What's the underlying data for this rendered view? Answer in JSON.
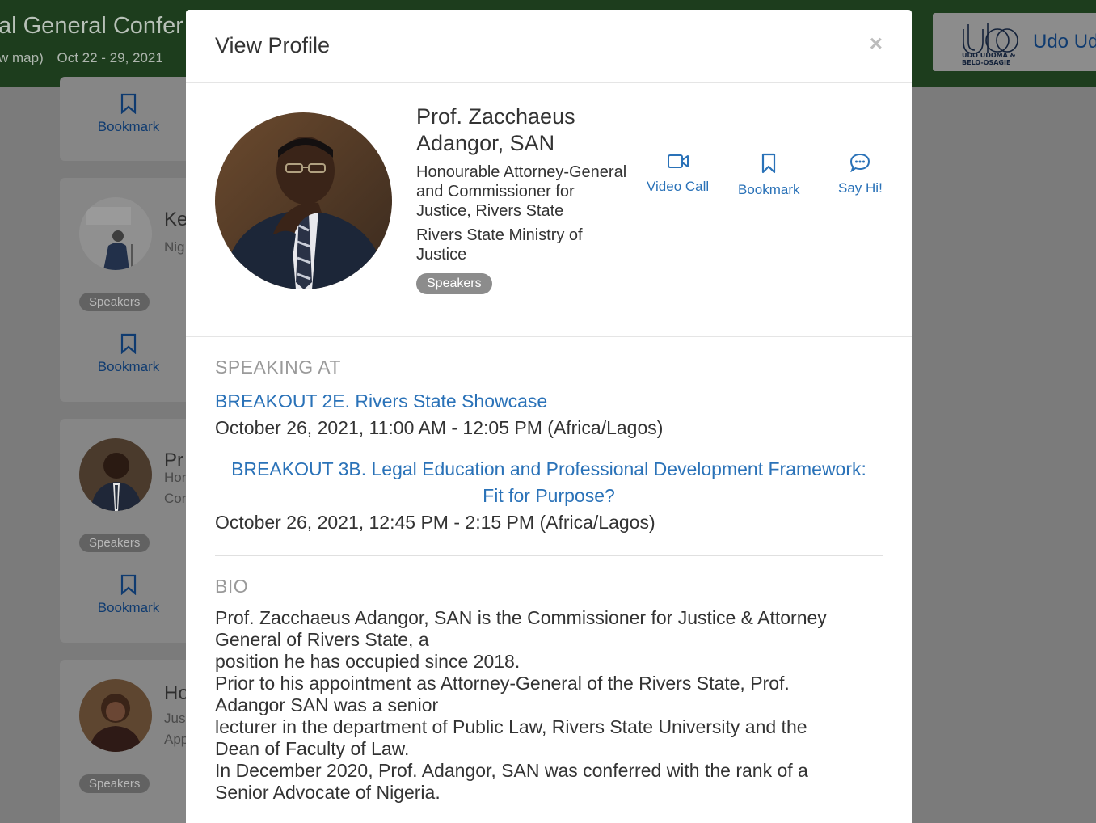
{
  "background": {
    "event_title": "al General Confer",
    "event_map_link": "w map)",
    "event_dates": "Oct 22 - 29, 2021",
    "sponsor": {
      "name": "Udo Ud",
      "logo_text_line1": "UDO UDOMA &",
      "logo_text_line2": "BELO-OSAGIE"
    },
    "cards": [
      {
        "bookmark_label": "Bookmark"
      },
      {
        "name": "Ke",
        "subtitle": "Nig",
        "tag": "Speakers",
        "bookmark_label": "Bookmark"
      },
      {
        "name": "Pr",
        "subtitle_line1": "Hor",
        "subtitle_line2": "Cor",
        "tag": "Speakers",
        "bookmark_label": "Bookmark"
      },
      {
        "name": "Ho",
        "subtitle_line1": "Jus",
        "subtitle_line2": "App",
        "tag": "Speakers"
      }
    ]
  },
  "modal": {
    "title": "View Profile",
    "close_symbol": "×",
    "profile": {
      "name": "Prof. Zacchaeus Adangor, SAN",
      "title": "Honourable Attorney-General and Commissioner for Justice, Rivers State",
      "organization": "Rivers State Ministry of Justice",
      "tag": "Speakers"
    },
    "actions": {
      "video_call": "Video Call",
      "bookmark": "Bookmark",
      "say_hi": "Say Hi!"
    },
    "speaking_at": {
      "heading": "SPEAKING AT",
      "sessions": [
        {
          "title": "BREAKOUT 2E. Rivers State Showcase",
          "time": "October 26, 2021, 11:00 AM - 12:05 PM (Africa/Lagos)"
        },
        {
          "title_line1": "BREAKOUT 3B. Legal Education and Professional Development Framework:",
          "title_line2": "Fit for Purpose?",
          "time": "October 26, 2021, 12:45 PM - 2:15 PM (Africa/Lagos)"
        }
      ]
    },
    "bio": {
      "heading": "BIO",
      "lines": [
        "Prof. Zacchaeus Adangor, SAN is the Commissioner for Justice & Attorney",
        "General of Rivers State, a",
        "position he has occupied since 2018.",
        "Prior to his appointment as Attorney-General of the Rivers State, Prof.",
        "Adangor SAN was a senior",
        "lecturer in the department of Public Law, Rivers State University and the",
        "Dean of Faculty of Law.",
        "In December 2020, Prof. Adangor, SAN was conferred with the rank of a",
        "Senior Advocate of Nigeria."
      ]
    }
  },
  "colors": {
    "link": "#2a72b8",
    "header_bg": "#1d3d1d",
    "overlay": "#7b7b7b",
    "tag_bg": "#8c8c8c"
  }
}
